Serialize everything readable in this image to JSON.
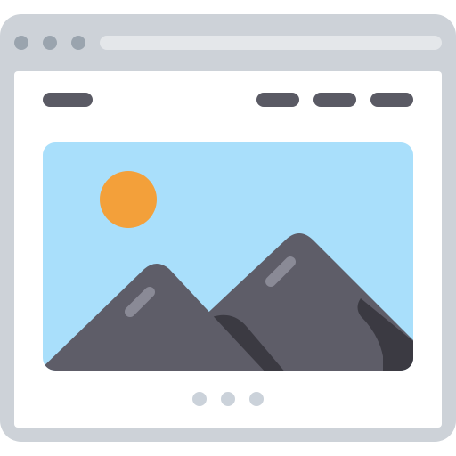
{
  "icon": {
    "name": "browser-window-image-slider-icon",
    "colors": {
      "frame": "#CDD2D8",
      "window_dots": "#9AA4AE",
      "address_bar": "#E4E7EA",
      "content_bg": "#FFFFFF",
      "nav_pills": "#5A5A64",
      "sky": "#A9DFFB",
      "sun": "#F3A03A",
      "mountain": "#5E5D68",
      "mountain_shadow": "#3B3A42",
      "highlight": "#8A8A96",
      "pager_dots": "#CBD2DA"
    },
    "window_controls": [
      "dot",
      "dot",
      "dot"
    ],
    "nav": {
      "logo_pill": "logo",
      "menu_pills": [
        "menu-1",
        "menu-2",
        "menu-3"
      ]
    },
    "slider": {
      "slides_total": 3
    }
  }
}
